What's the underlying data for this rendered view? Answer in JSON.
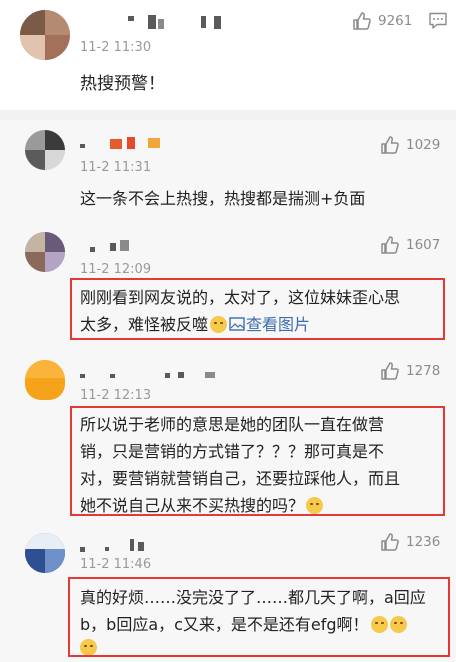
{
  "main_comment": {
    "time": "11-2 11:30",
    "likes": "9261",
    "text": "热搜预警！"
  },
  "replies": [
    {
      "time": "11-2 11:31",
      "likes": "1029",
      "lines": [
        "这一条不会上热搜，热搜都是揣测+负面"
      ]
    },
    {
      "time": "11-2 12:09",
      "likes": "1607",
      "lines": [
        "刚刚看到网友说的，太对了，这位妹妹歪心思",
        "太多，难怪被反噬"
      ],
      "link_icon": "image-icon",
      "link_text": "查看图片"
    },
    {
      "time": "11-2 12:13",
      "likes": "1278",
      "lines": [
        "所以说于老师的意思是她的团队一直在做营",
        "销，只是营销的方式错了？？？那可真是不",
        "对，要营销就营销自己，还要拉踩他人，而且",
        "她不说自己从来不买热搜的吗？"
      ]
    },
    {
      "time": "11-2 11:46",
      "likes": "1236",
      "lines": [
        "真的好烦……没完没了了……都几天了啊，a回应",
        "b，b回应a，c又来，是不是还有efg啊！"
      ]
    }
  ],
  "colors": {
    "highlight_border": "#e53935",
    "link": "#3c6db1",
    "background": "#f7f7f7"
  },
  "icons": {
    "like": "thumbs-up-icon",
    "reply": "comment-bubble-icon",
    "emoji": "smile-emoji-icon"
  }
}
